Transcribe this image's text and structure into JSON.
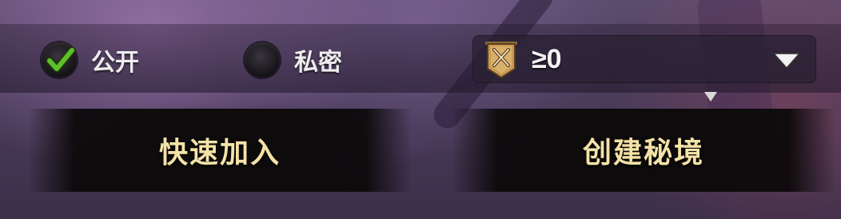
{
  "visibility": {
    "public_label": "公开",
    "private_label": "私密",
    "selected": "public"
  },
  "level_filter": {
    "value": "≥0",
    "icon": "crossed-swords-banner-icon"
  },
  "actions": {
    "quick_join_label": "快速加入",
    "create_label": "创建秘境"
  },
  "colors": {
    "button_text": "#f4e2a7",
    "check": "#5fbf2a"
  }
}
